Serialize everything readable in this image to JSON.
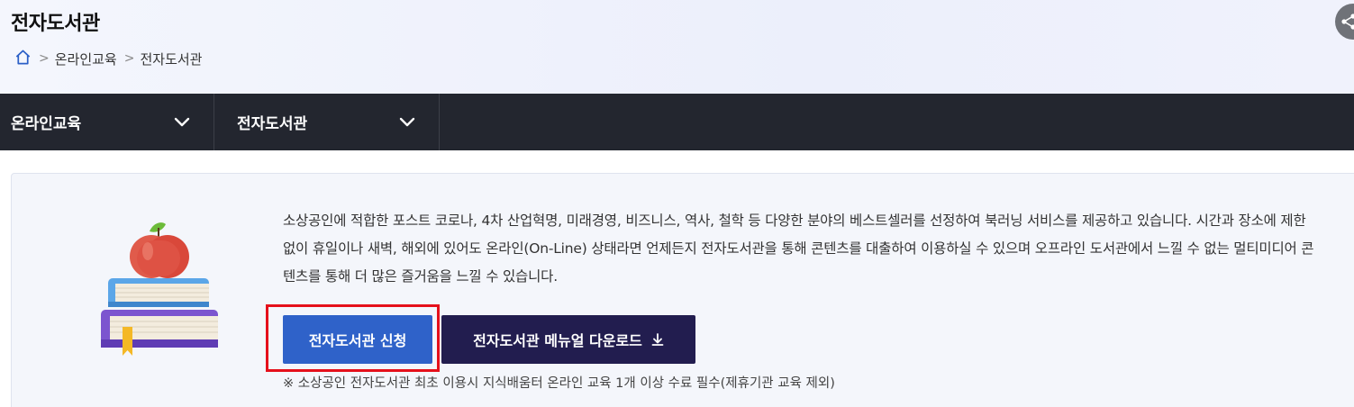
{
  "header": {
    "title": "전자도서관",
    "breadcrumb": {
      "home_icon": "home-icon",
      "items": [
        "온라인교육",
        "전자도서관"
      ],
      "separator": ">"
    },
    "share_icon": "share-icon"
  },
  "nav": {
    "items": [
      {
        "label": "온라인교육",
        "icon": "chevron-down-icon"
      },
      {
        "label": "전자도서관",
        "icon": "chevron-down-icon"
      }
    ]
  },
  "intro": {
    "illustration": "apple-on-books-illustration",
    "description": "소상공인에 적합한 포스트 코로나, 4차 산업혁명, 미래경영, 비즈니스, 역사, 철학 등 다양한 분야의 베스트셀러를 선정하여 북러닝 서비스를 제공하고 있습니다. 시간과 장소에 제한 없이 휴일이나 새벽, 해외에 있어도 온라인(On-Line) 상태라면 언제든지 전자도서관을 통해 콘텐츠를 대출하여 이용하실 수 있으며 오프라인 도서관에서 느낄 수 없는 멀티미디어 콘텐츠를 통해 더 많은 즐거움을 느낄 수 있습니다.",
    "apply_button": "전자도서관 신청",
    "manual_button": "전자도서관 메뉴얼 다운로드",
    "manual_icon": "download-icon",
    "note": "※ 소상공인 전자도서관 최초 이용시 지식배움터 온라인 교육 1개 이상 수료 필수(제휴기관 교육 제외)"
  },
  "colors": {
    "nav_bg": "#23262f",
    "apply_btn": "#2f62c9",
    "manual_btn": "#221d4f",
    "highlight": "#e5101b"
  }
}
